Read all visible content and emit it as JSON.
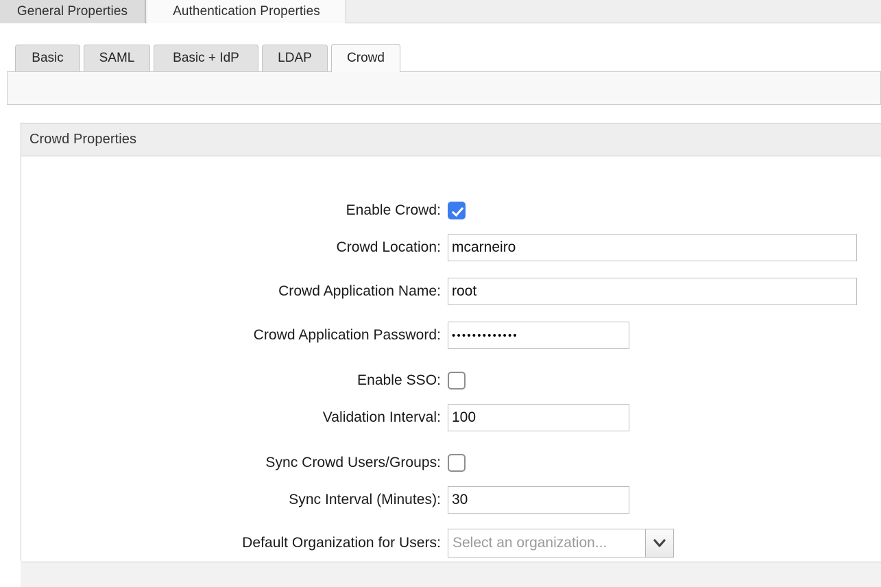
{
  "top_tabs": [
    {
      "label": "General Properties",
      "active": false
    },
    {
      "label": "Authentication Properties",
      "active": true
    }
  ],
  "sub_tabs": [
    {
      "label": "Basic",
      "active": false
    },
    {
      "label": "SAML",
      "active": false
    },
    {
      "label": "Basic + IdP",
      "active": false
    },
    {
      "label": "LDAP",
      "active": false
    },
    {
      "label": "Crowd",
      "active": true
    }
  ],
  "panel": {
    "title": "Crowd Properties"
  },
  "form": {
    "enable_crowd": {
      "label": "Enable Crowd:",
      "checked": true
    },
    "crowd_location": {
      "label": "Crowd Location:",
      "value": "mcarneiro"
    },
    "crowd_application_name": {
      "label": "Crowd Application Name:",
      "value": "root"
    },
    "crowd_application_password": {
      "label": "Crowd Application Password:",
      "masked_value": "•••••••••••••"
    },
    "enable_sso": {
      "label": "Enable SSO:",
      "checked": false
    },
    "validation_interval": {
      "label": "Validation Interval:",
      "value": "100"
    },
    "sync_crowd_users_groups": {
      "label": "Sync Crowd Users/Groups:",
      "checked": false
    },
    "sync_interval_minutes": {
      "label": "Sync Interval (Minutes):",
      "value": "30"
    },
    "default_organization": {
      "label": "Default Organization for Users:",
      "placeholder": "Select an organization...",
      "selected": "",
      "dropdown_icon": "chevron-down-icon"
    }
  },
  "colors": {
    "checkbox_accent": "#3b7cef",
    "panel_header_bg": "#eeeeee",
    "tab_inactive_bg": "#dcdcdc",
    "border": "#c9c9c9"
  }
}
